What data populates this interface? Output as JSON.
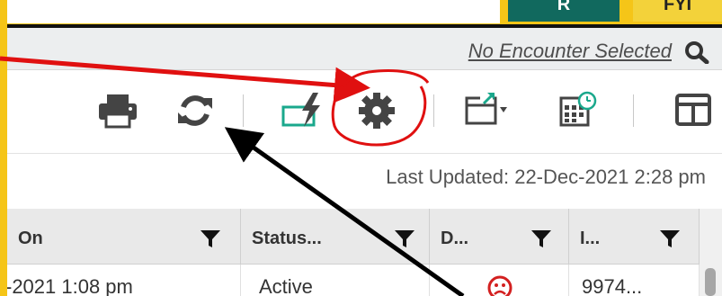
{
  "tabs": {
    "r_label": "R",
    "fyi_label": "FYI"
  },
  "encounter": {
    "link_text": "No Encounter Selected"
  },
  "toolbar": {
    "icons": [
      "print-icon",
      "refresh-icon",
      "quick-action-icon",
      "settings-gear-icon",
      "popout-icon",
      "calendar-icon",
      "layout-icon"
    ]
  },
  "status": {
    "last_updated": "Last Updated: 22-Dec-2021 2:28 pm"
  },
  "grid": {
    "columns": [
      "On",
      "Status...",
      "D...",
      "I..."
    ],
    "row": {
      "on": "-2021 1:08 pm",
      "status": "Active",
      "d": "sad-face-icon",
      "i": "9974..."
    }
  },
  "colors": {
    "highlight_border": "#f5c518",
    "annotation_red": "#e01010",
    "annotation_black": "#000000",
    "accent_teal": "#1aa88c"
  }
}
